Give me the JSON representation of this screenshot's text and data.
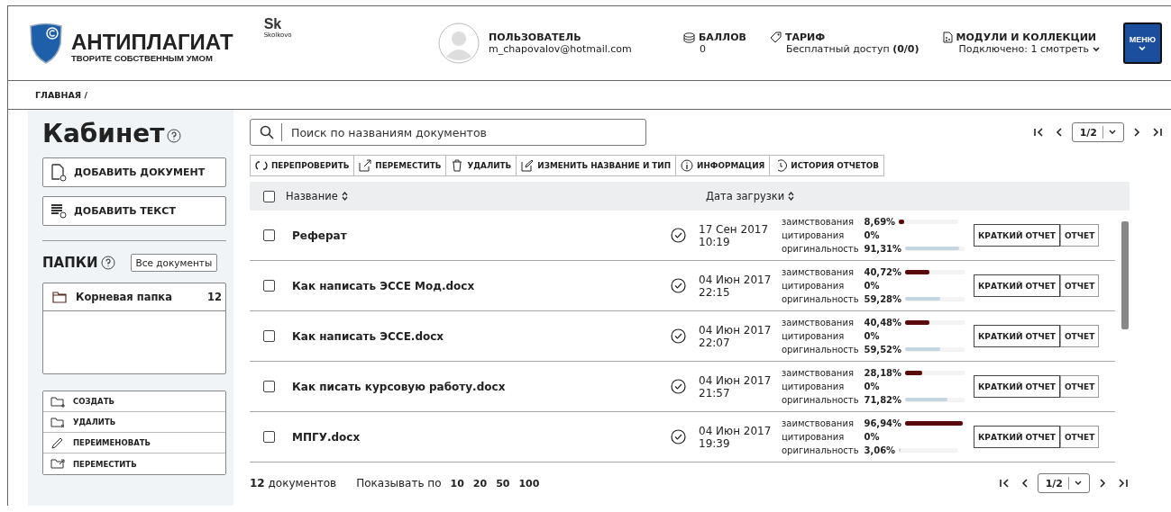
{
  "header": {
    "logo": {
      "title": "АНТИПЛАГИАТ",
      "tagline": "ТВОРИТЕ СОБСТВЕННЫМ УМОМ"
    },
    "partner": {
      "mark": "Sk",
      "name": "Skolkovo"
    },
    "user": {
      "label": "ПОЛЬЗОВАТЕЛЬ",
      "email": "m_chapovalov@hotmail.com"
    },
    "points": {
      "label": "БАЛЛОВ",
      "value": "0"
    },
    "tariff": {
      "label": "ТАРИФ",
      "value": "Бесплатный доступ **(0/0)**"
    },
    "modules": {
      "label": "МОДУЛИ И КОЛЛЕКЦИИ",
      "value": "Подключено: 1 смотреть"
    },
    "menu_button": "МЕНЮ"
  },
  "breadcrumb": "ГЛАВНАЯ /",
  "sidebar": {
    "title": "Кабинет",
    "actions": [
      {
        "label": "ДОБАВИТЬ ДОКУМЕНТ",
        "kind": "document"
      },
      {
        "label": "ДОБАВИТЬ ТЕКСТ",
        "kind": "text"
      }
    ],
    "folders_title": "ПАПКИ",
    "all_documents": "Все документы",
    "folders": [
      {
        "name": "Корневая папка",
        "count": "12"
      }
    ],
    "folder_actions": [
      {
        "label": "СОЗДАТЬ",
        "kind": "create"
      },
      {
        "label": "УДАЛИТЬ",
        "kind": "delete"
      },
      {
        "label": "ПЕРЕИМЕНОВАТЬ",
        "kind": "rename"
      },
      {
        "label": "ПЕРЕМЕСТИТЬ",
        "kind": "move"
      }
    ]
  },
  "search": {
    "placeholder": "Поиск по названиям документов"
  },
  "pager_top": {
    "page": "1/2"
  },
  "toolbar": [
    {
      "label": "ПЕРЕПРОВЕРИТЬ",
      "kind": "recheck"
    },
    {
      "label": "ПЕРЕМЕСТИТЬ",
      "kind": "move"
    },
    {
      "label": "УДАЛИТЬ",
      "kind": "delete"
    },
    {
      "label": "ИЗМЕНИТЬ НАЗВАНИЕ И ТИП",
      "kind": "edit"
    },
    {
      "label": "ИНФОРМАЦИЯ",
      "kind": "info"
    },
    {
      "label": "ИСТОРИЯ ОТЧЕТОВ",
      "kind": "history"
    }
  ],
  "table": {
    "select_all": {
      "checked": false
    },
    "columns": [
      "Название",
      "Дата загрузки"
    ],
    "rows": [
      {
        "checked": false,
        "name": "Реферат",
        "date": "17 Сен 2017",
        "time": "10:19",
        "borrow_label": "заимствования",
        "borrow": {
          "text": "8,69%",
          "level": 0.0869
        },
        "cite_label": "цитирования",
        "cite": "0%",
        "orig_label": "оригинальность",
        "orig": {
          "text": "91,31%",
          "level": 0.9131
        },
        "short_report": "КРАТКИЙ ОТЧЕТ",
        "report": "ОТЧЕТ"
      },
      {
        "checked": false,
        "name": "Как написать ЭССЕ Мод.docx",
        "date": "04 Июн 2017",
        "time": "22:15",
        "borrow_label": "заимствования",
        "borrow": {
          "text": "40,72%",
          "level": 0.4072
        },
        "cite_label": "цитирования",
        "cite": "0%",
        "orig_label": "оригинальность",
        "orig": {
          "text": "59,28%",
          "level": 0.5928
        },
        "short_report": "КРАТКИЙ ОТЧЕТ",
        "report": "ОТЧЕТ"
      },
      {
        "checked": false,
        "name": "Как написать ЭССЕ.docx",
        "date": "04 Июн 2017",
        "time": "22:07",
        "borrow_label": "заимствования",
        "borrow": {
          "text": "40,48%",
          "level": 0.4048
        },
        "cite_label": "цитирования",
        "cite": "0%",
        "orig_label": "оригинальность",
        "orig": {
          "text": "59,52%",
          "level": 0.5952
        },
        "short_report": "КРАТКИЙ ОТЧЕТ",
        "report": "ОТЧЕТ"
      },
      {
        "checked": false,
        "name": "Как писать курсовую работу.docx",
        "date": "04 Июн 2017",
        "time": "21:57",
        "borrow_label": "заимствования",
        "borrow": {
          "text": "28,18%",
          "level": 0.2818
        },
        "cite_label": "цитирования",
        "cite": "0%",
        "orig_label": "оригинальность",
        "orig": {
          "text": "71,82%",
          "level": 0.7182
        },
        "short_report": "КРАТКИЙ ОТЧЕТ",
        "report": "ОТЧЕТ"
      },
      {
        "checked": false,
        "name": "МПГУ.docx",
        "date": "04 Июн 2017",
        "time": "19:39",
        "borrow_label": "заимствования",
        "borrow": {
          "text": "96,94%",
          "level": 0.9694
        },
        "cite_label": "цитирования",
        "cite": "0%",
        "orig_label": "оригинальность",
        "orig": {
          "text": "3,06%",
          "level": 0.0306
        },
        "short_report": "КРАТКИЙ ОТЧЕТ",
        "report": "ОТЧЕТ"
      }
    ]
  },
  "footer": {
    "count": "**12** документов",
    "page_size_label": "Показывать по",
    "page_sizes": [
      "10",
      "20",
      "50",
      "100"
    ]
  },
  "pager_bottom": {
    "page": "1/2"
  }
}
